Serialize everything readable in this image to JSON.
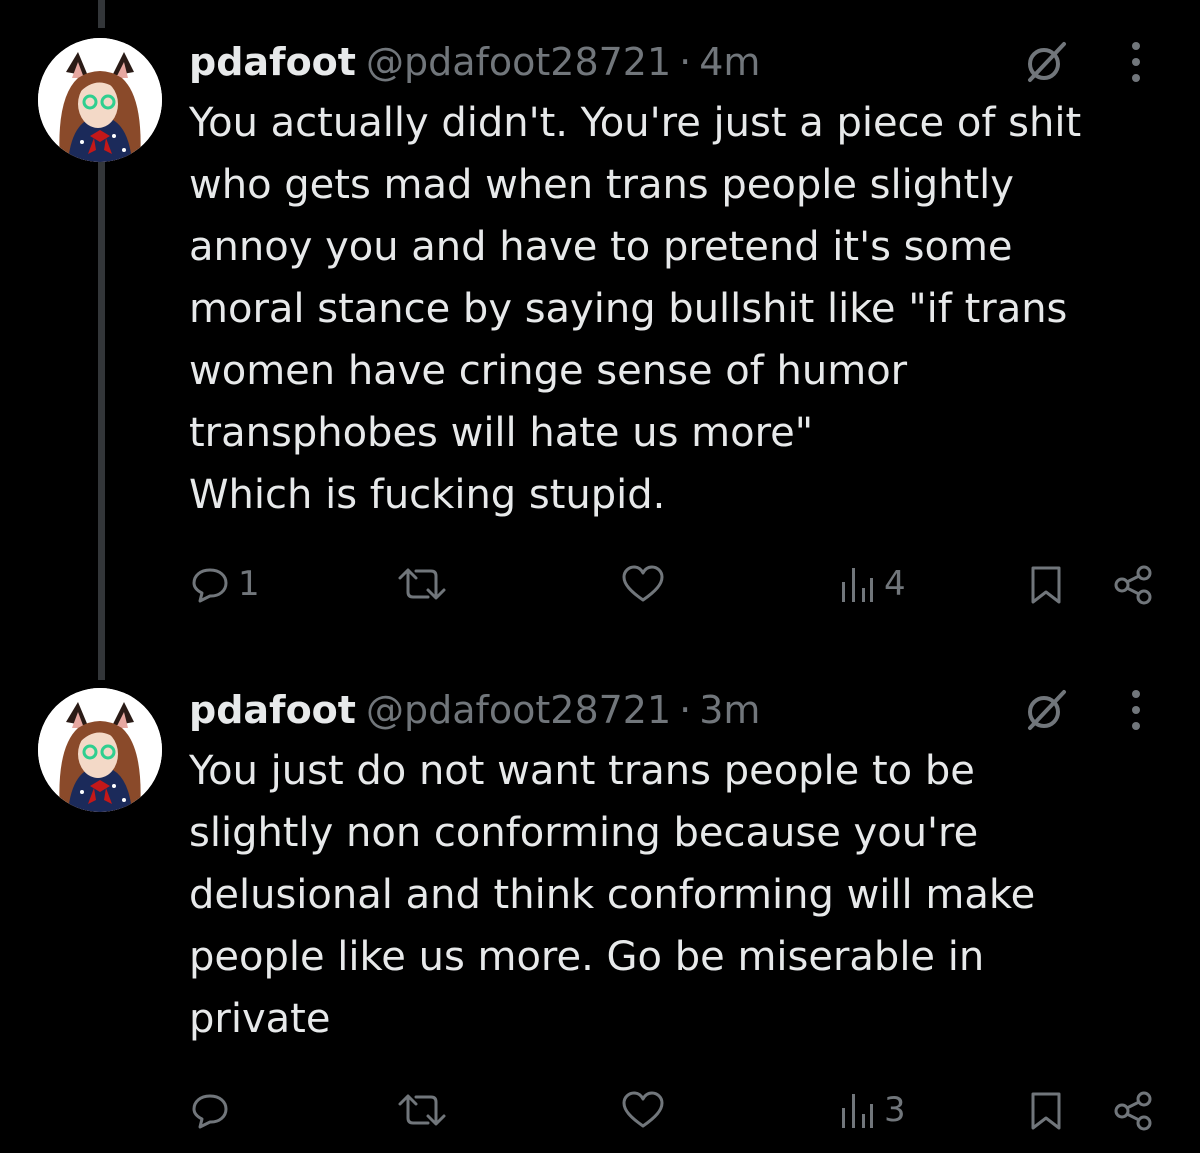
{
  "colors": {
    "background": "#000000",
    "text": "#e7e9ea",
    "muted": "#71767b",
    "thread_line": "#333639"
  },
  "tweets": [
    {
      "author": {
        "display_name": "pdafoot",
        "handle": "@pdafoot28721"
      },
      "separator": "·",
      "time": "4m",
      "text": "You actually didn't. You're just a piece of shit\nwho gets mad when trans people slightly\nannoy you and have to pretend it's some\nmoral stance by saying bullshit like \"if trans\nwomen have cringe sense of humor\ntransphobes will hate us more\"\nWhich is fucking stupid.",
      "actions": {
        "reply_icon": "comment-icon",
        "reply_count": "1",
        "repost_icon": "repost-icon",
        "like_icon": "heart-icon",
        "views_icon": "bar-chart-icon",
        "views_count": "4",
        "bookmark_icon": "bookmark-icon",
        "share_icon": "share-icon"
      }
    },
    {
      "author": {
        "display_name": "pdafoot",
        "handle": "@pdafoot28721"
      },
      "separator": "·",
      "time": "3m",
      "text": "You just do not want trans people to be\nslightly non conforming because you're\ndelusional and think conforming will make\npeople like us more. Go be miserable in\nprivate",
      "actions": {
        "reply_icon": "comment-icon",
        "reply_count": "",
        "repost_icon": "repost-icon",
        "like_icon": "heart-icon",
        "views_icon": "bar-chart-icon",
        "views_count": "3",
        "bookmark_icon": "bookmark-icon",
        "share_icon": "share-icon"
      }
    }
  ]
}
